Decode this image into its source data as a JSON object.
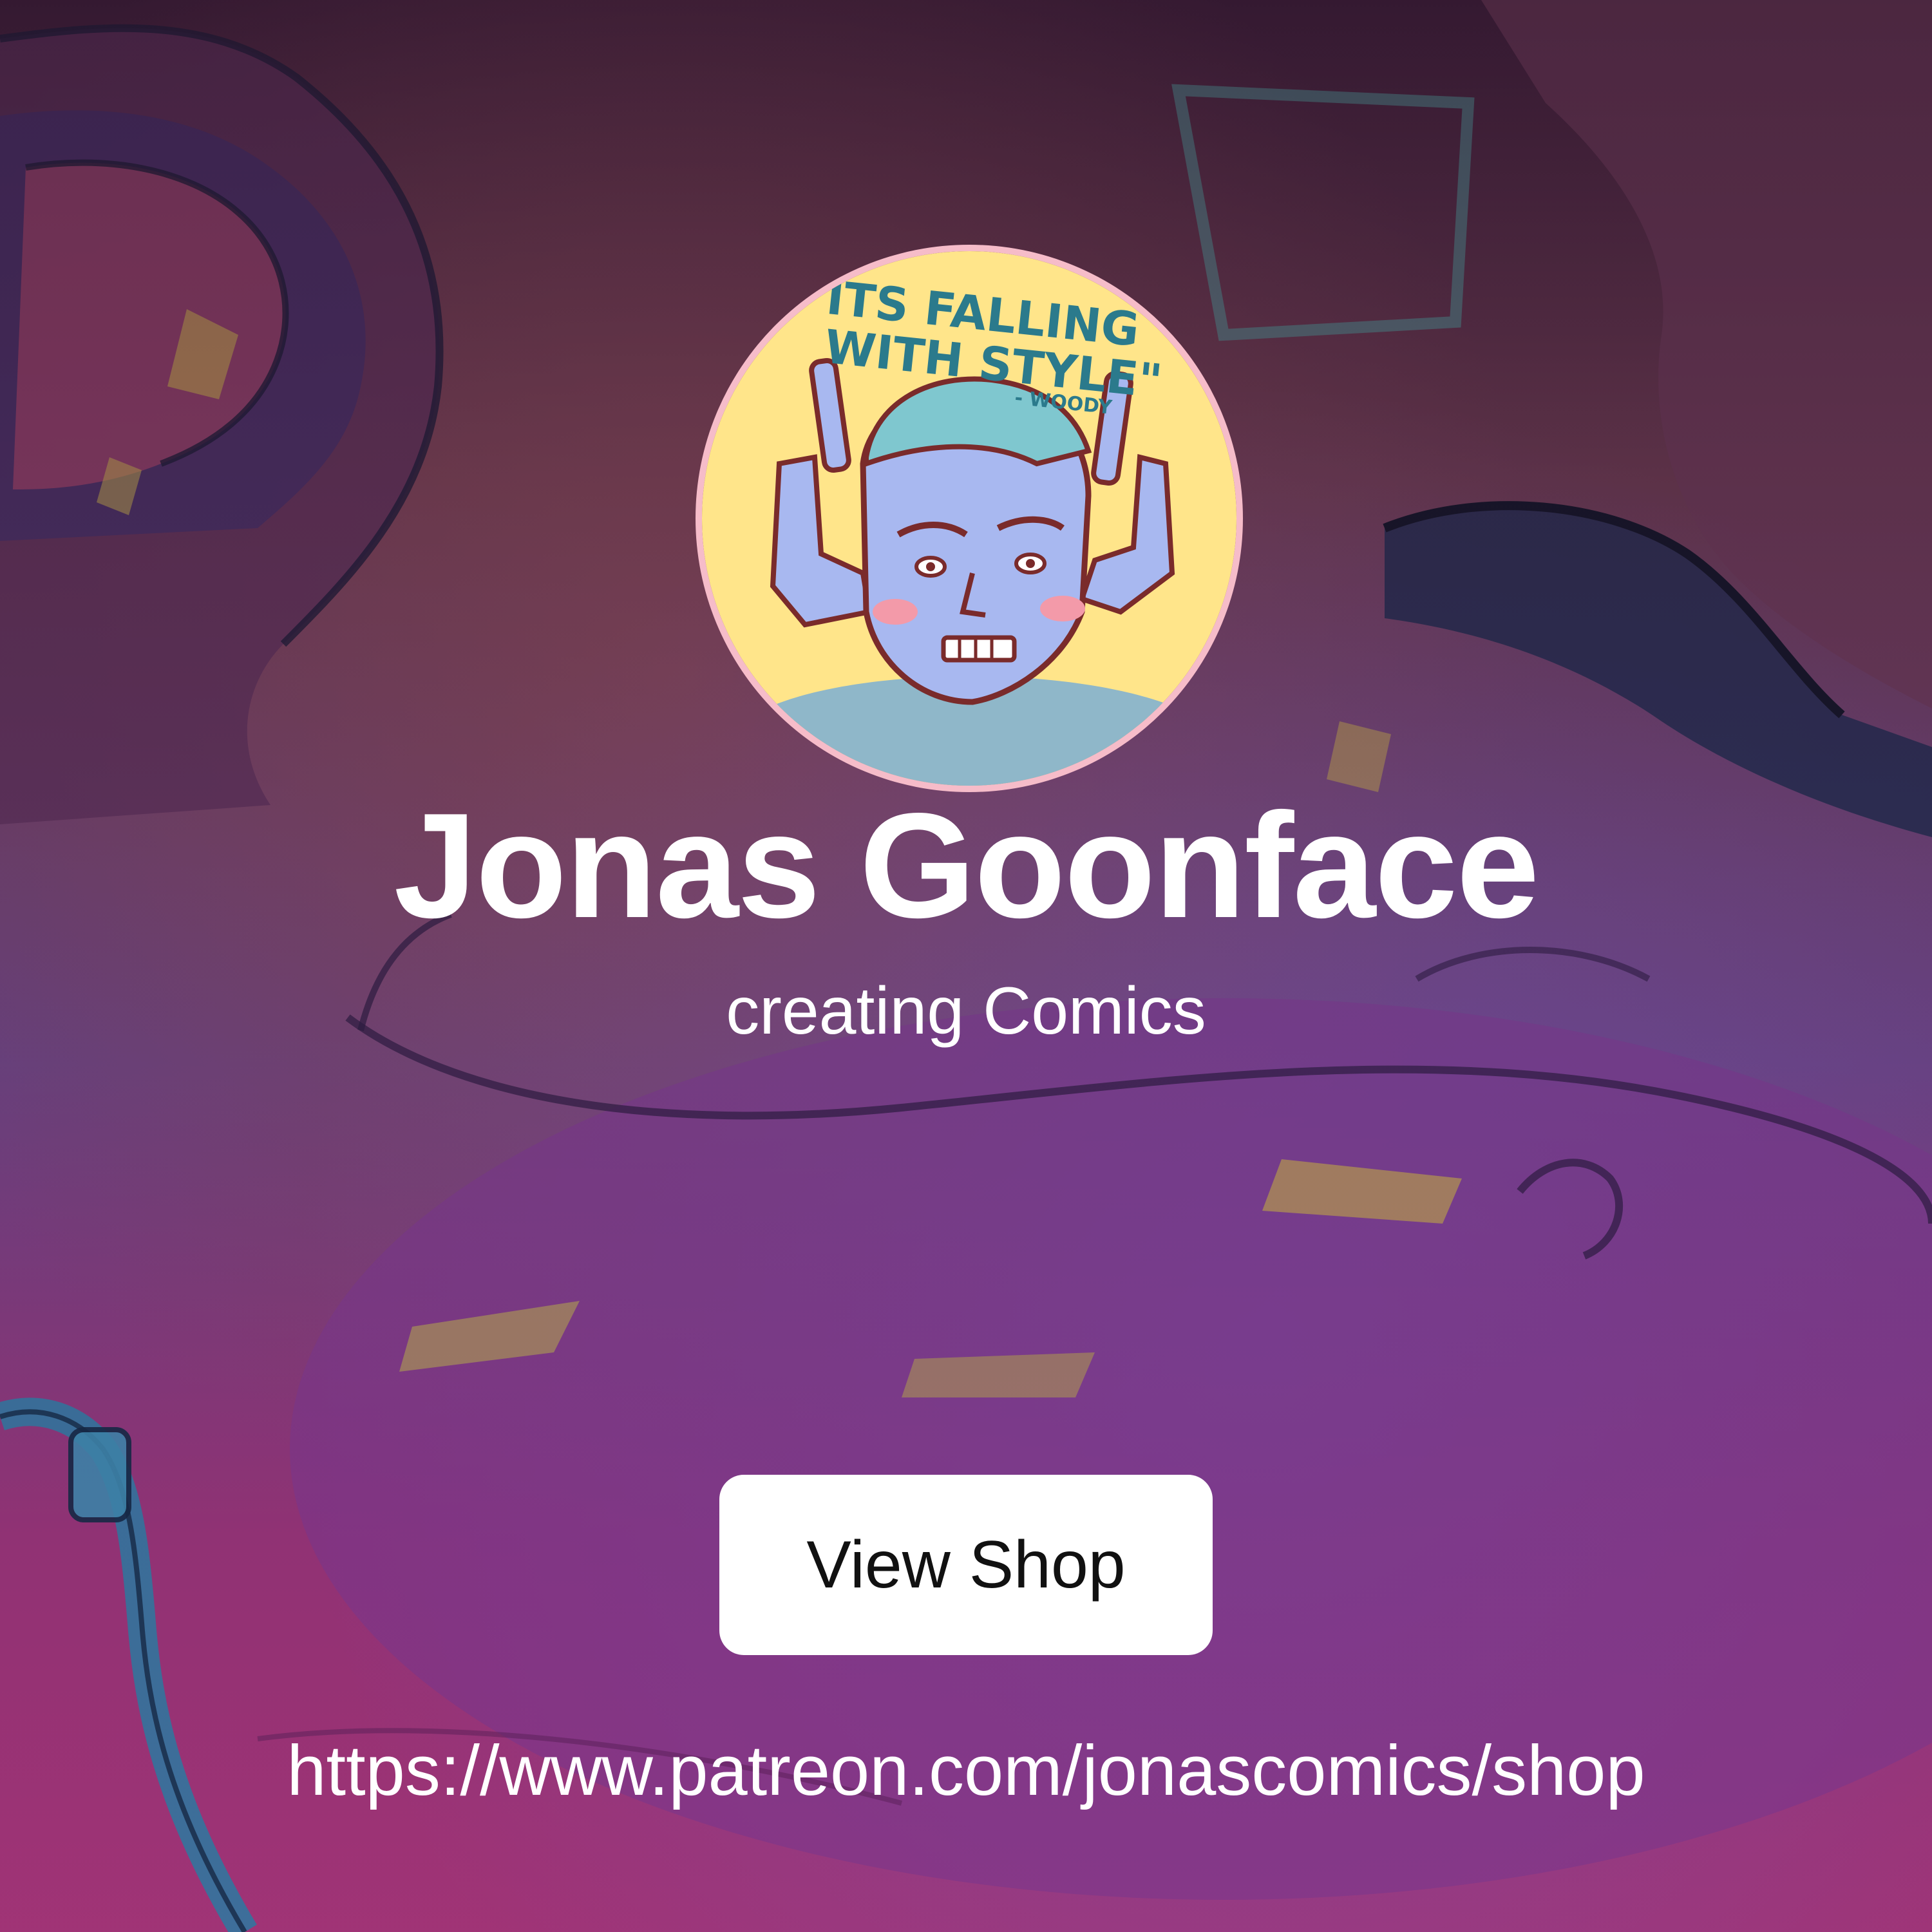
{
  "profile": {
    "name": "Jonas Goonface",
    "tagline": "creating Comics",
    "avatar_caption_line1": "\"ITS FALLING",
    "avatar_caption_line2": "WITH STYLE\"",
    "avatar_caption_credit": "- WOODY"
  },
  "actions": {
    "view_shop_label": "View Shop"
  },
  "link": {
    "url": "https://www.patreon.com/jonascomics/shop"
  },
  "colors": {
    "background_top": "#5b2a4a",
    "background_bottom": "#a12d72",
    "button_bg": "#ffffff",
    "text": "#ffffff",
    "avatar_bg": "#ffe58a",
    "avatar_ring": "#f6bcc9"
  }
}
